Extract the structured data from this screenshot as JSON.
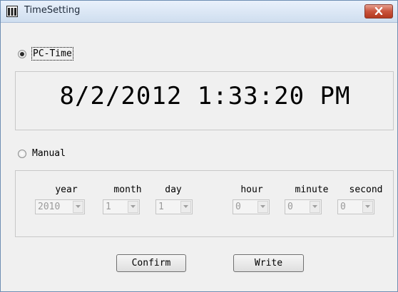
{
  "window": {
    "title": "TimeSetting"
  },
  "pc_time": {
    "label": "PC-Time",
    "selected": true,
    "display": "8/2/2012 1:33:20 PM"
  },
  "manual": {
    "label": "Manual",
    "selected": false,
    "fields": [
      {
        "label": "year",
        "value": "2010"
      },
      {
        "label": "month",
        "value": "1"
      },
      {
        "label": "day",
        "value": "1"
      },
      {
        "label": "hour",
        "value": "0"
      },
      {
        "label": "minute",
        "value": "0"
      },
      {
        "label": "second",
        "value": "0"
      }
    ]
  },
  "buttons": {
    "confirm": "Confirm",
    "write": "Write"
  }
}
